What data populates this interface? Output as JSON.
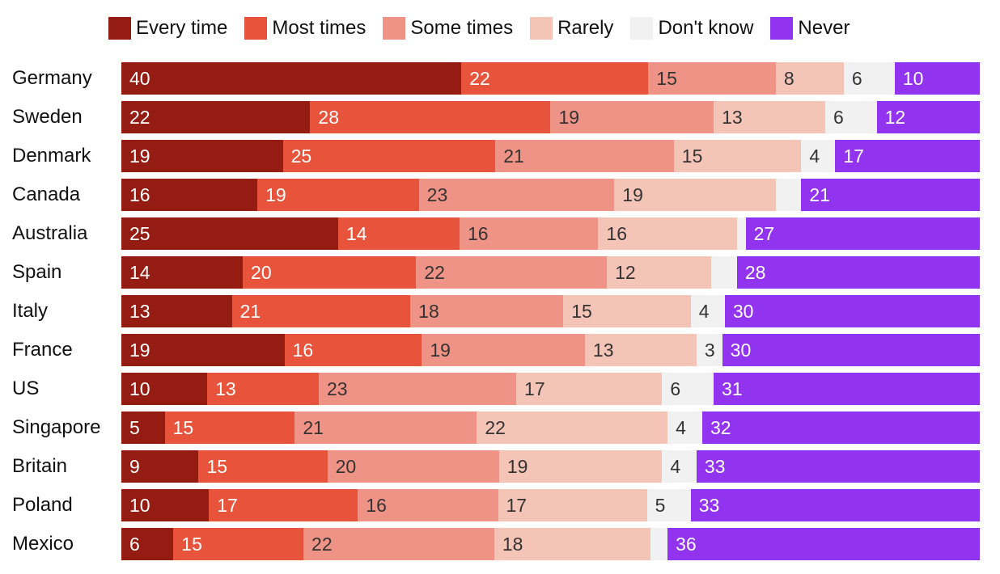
{
  "chart_data": {
    "type": "bar",
    "orientation": "horizontal",
    "stacked": true,
    "title": "",
    "xlabel": "",
    "ylabel": "",
    "legend_position": "top",
    "grid": false,
    "categories": [
      "Germany",
      "Sweden",
      "Denmark",
      "Canada",
      "Australia",
      "Spain",
      "Italy",
      "France",
      "US",
      "Singapore",
      "Britain",
      "Poland",
      "Mexico"
    ],
    "series": [
      {
        "name": "Every time",
        "color": "#941c12",
        "label_color": "#ffffff",
        "values": [
          40,
          22,
          19,
          16,
          25,
          14,
          13,
          19,
          10,
          5,
          9,
          10,
          6
        ],
        "labeled": [
          true,
          true,
          true,
          true,
          true,
          true,
          true,
          true,
          true,
          true,
          true,
          true,
          true
        ]
      },
      {
        "name": "Most times",
        "color": "#e8533c",
        "label_color": "#ffffff",
        "values": [
          22,
          28,
          25,
          19,
          14,
          20,
          21,
          16,
          13,
          15,
          15,
          17,
          15
        ],
        "labeled": [
          true,
          true,
          true,
          true,
          true,
          true,
          true,
          true,
          true,
          true,
          true,
          true,
          true
        ]
      },
      {
        "name": "Some times",
        "color": "#ef9387",
        "label_color": "#333333",
        "values": [
          15,
          19,
          21,
          23,
          16,
          22,
          18,
          19,
          23,
          21,
          20,
          16,
          22
        ],
        "labeled": [
          true,
          true,
          true,
          true,
          true,
          true,
          true,
          true,
          true,
          true,
          true,
          true,
          true
        ]
      },
      {
        "name": "Rarely",
        "color": "#f4c4b6",
        "label_color": "#333333",
        "values": [
          8,
          13,
          15,
          19,
          16,
          12,
          15,
          13,
          17,
          22,
          19,
          17,
          18
        ],
        "labeled": [
          true,
          true,
          true,
          true,
          true,
          true,
          true,
          true,
          true,
          true,
          true,
          true,
          true
        ]
      },
      {
        "name": "Don't know",
        "color": "#f1f1f1",
        "label_color": "#333333",
        "values": [
          6,
          6,
          4,
          3,
          1,
          3,
          4,
          3,
          6,
          4,
          4,
          5,
          2
        ],
        "labeled": [
          true,
          true,
          true,
          false,
          false,
          false,
          true,
          true,
          true,
          true,
          true,
          true,
          false
        ]
      },
      {
        "name": "Never",
        "color": "#9233f0",
        "label_color": "#ffffff",
        "values": [
          10,
          12,
          17,
          21,
          27,
          28,
          30,
          30,
          31,
          32,
          33,
          33,
          36
        ],
        "labeled": [
          true,
          true,
          true,
          true,
          true,
          true,
          true,
          true,
          true,
          true,
          true,
          true,
          true
        ]
      }
    ]
  }
}
